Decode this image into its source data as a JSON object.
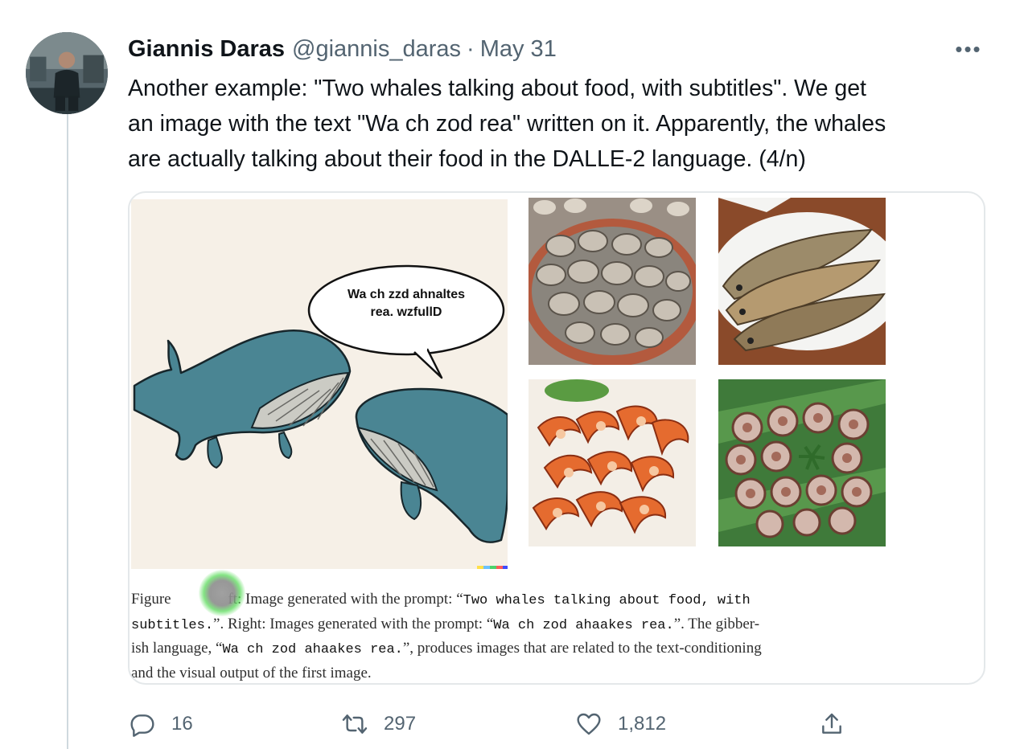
{
  "tweet": {
    "author_name": "Giannis Daras",
    "author_handle": "@giannis_daras",
    "separator": "·",
    "date": "May 31",
    "more_label": "•••",
    "text_lines": [
      "Another example: \"Two whales talking about food, with subtitles\". We get",
      "an image with the text \"Wa ch zod rea\" written on it. Apparently, the whales",
      "are actually talking about their food in the DALLE-2 language. (4/n)"
    ]
  },
  "media": {
    "speech_bubble": {
      "line1": "Wa ch zzd ahnaltes",
      "line2": "rea. wzfullD"
    },
    "food_tiles": [
      "clams-image",
      "grilled-fish-image",
      "shrimp-image",
      "sliced-sausage-image"
    ],
    "caption": {
      "p1": "Figure ",
      "p2": "ft: Image generated with the prompt: “",
      "m1": "Two whales talking about food, with",
      "m2": "subtitles.",
      "p3": "”. Right: Images generated with the prompt: “",
      "m3": "Wa ch zod ahaakes rea.",
      "p4": "”. The gibber-",
      "p5": "ish language, “",
      "m4": "Wa ch zod ahaakes rea.",
      "p6": "”, produces images that are related to the text-conditioning",
      "p7": "and the visual output of the first image."
    }
  },
  "actions": {
    "reply": {
      "icon": "reply-icon",
      "count": "16"
    },
    "retweet": {
      "icon": "retweet-icon",
      "count": "297"
    },
    "like": {
      "icon": "heart-icon",
      "count": "1,812"
    },
    "share": {
      "icon": "share-icon"
    }
  },
  "colors": {
    "text_primary": "#0f1419",
    "text_secondary": "#536471",
    "border": "#e4e8ea",
    "whale": "#4a8593"
  }
}
